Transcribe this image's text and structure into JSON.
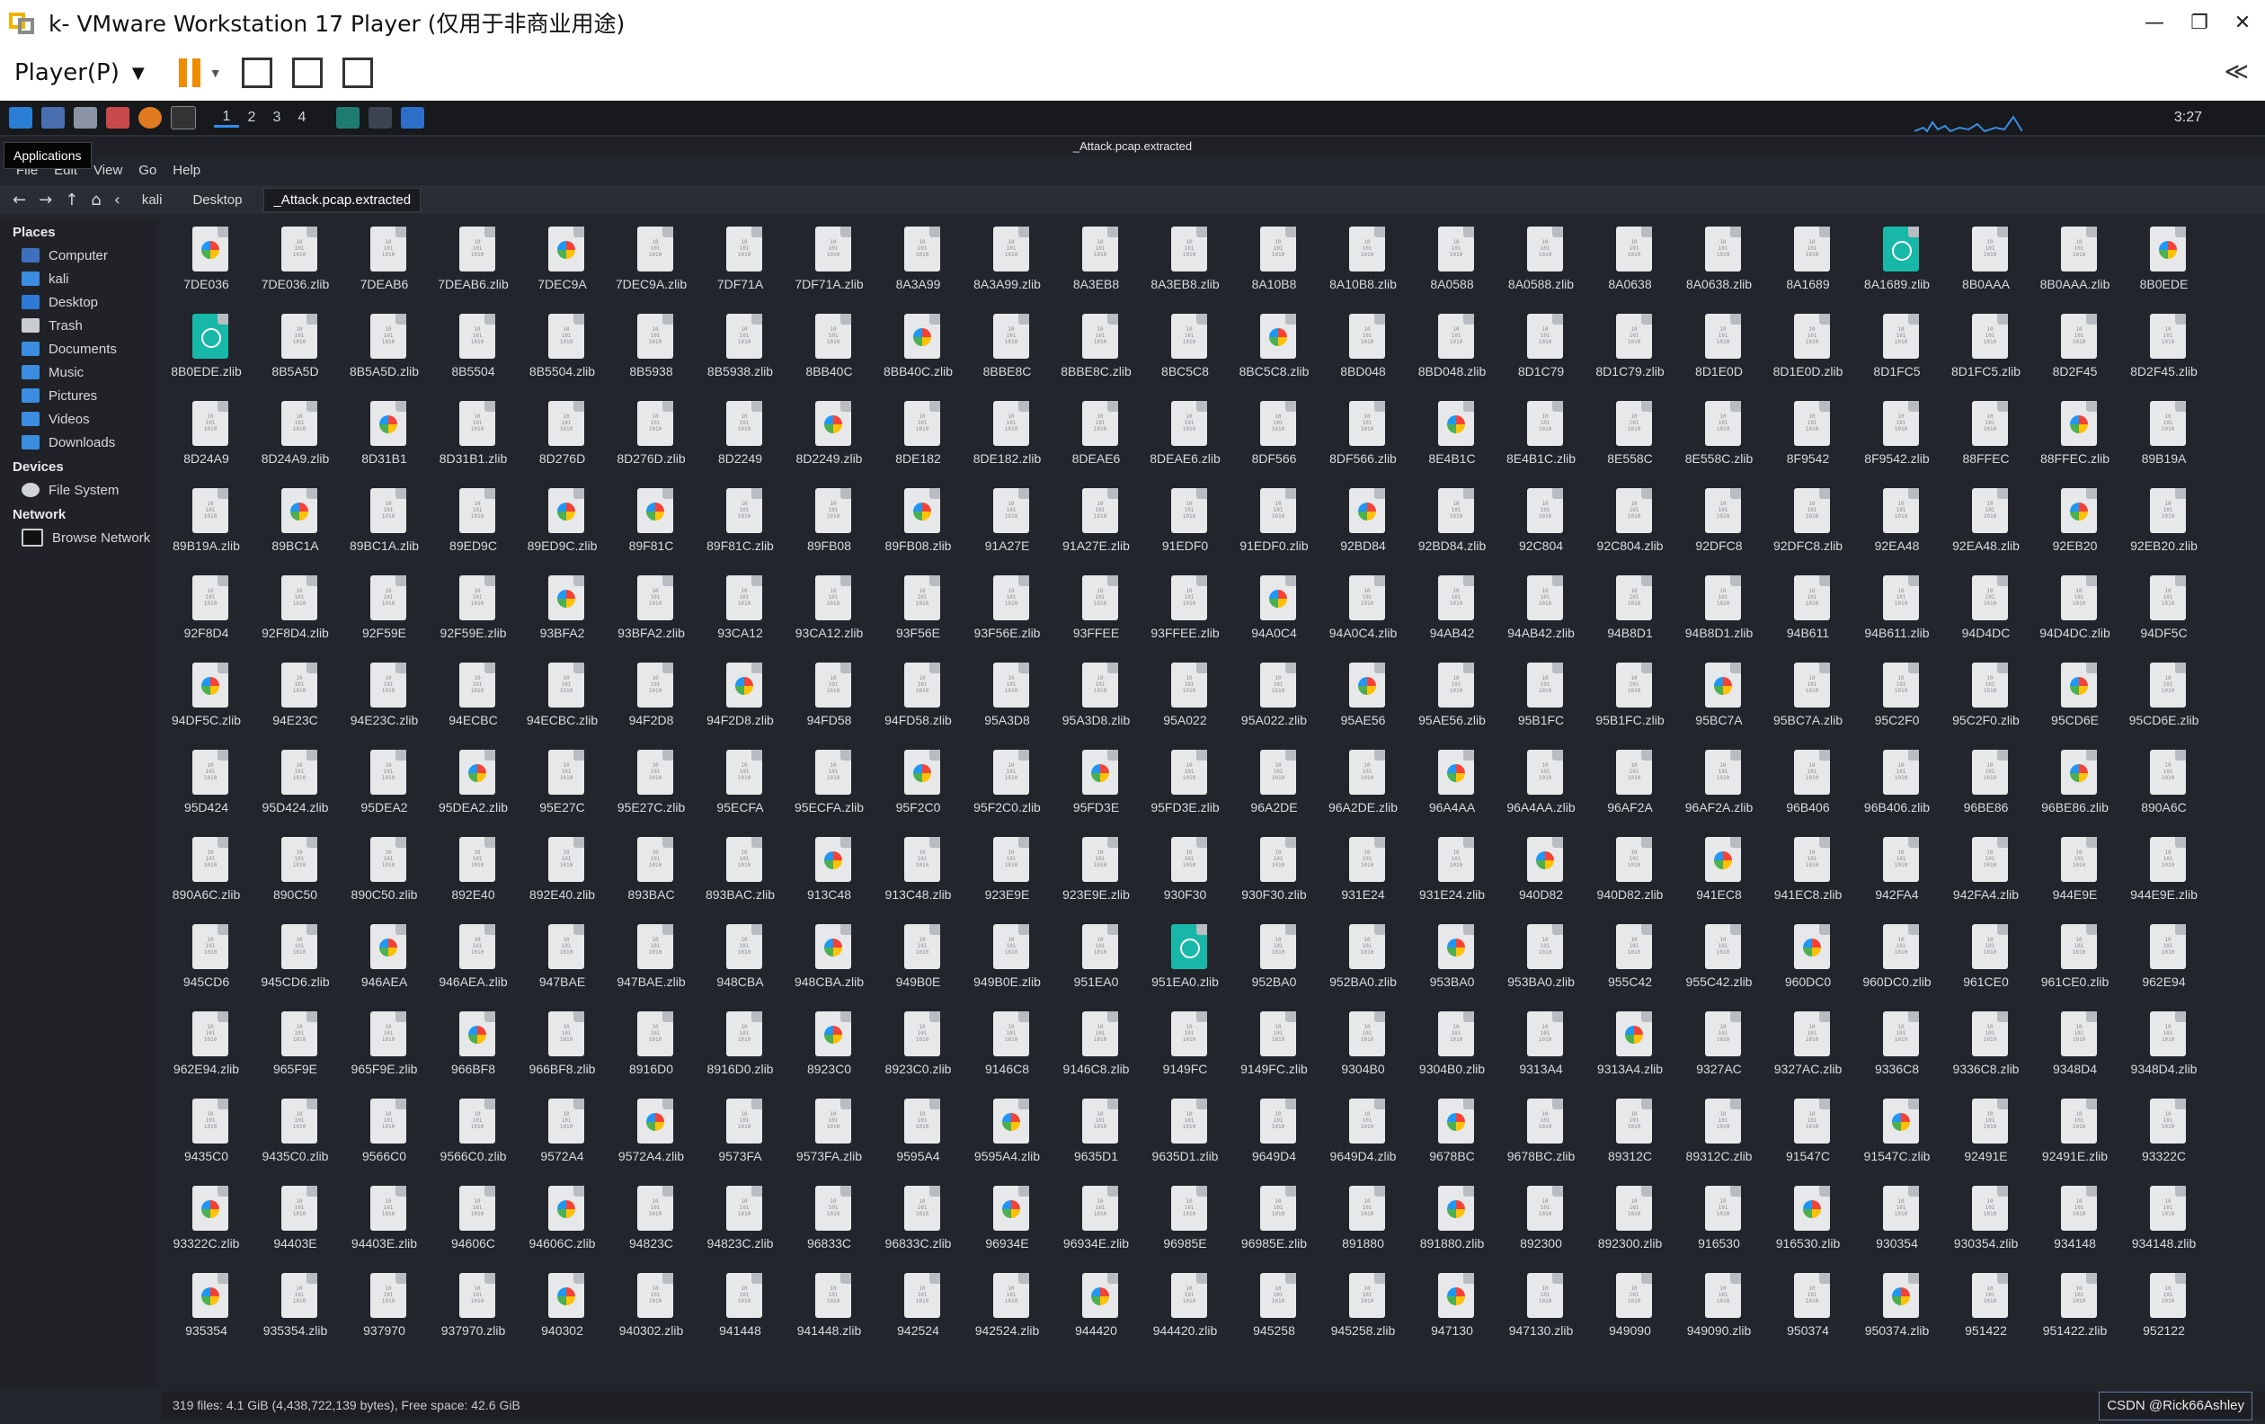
{
  "host": {
    "title": "k- VMware Workstation 17 Player (仅用于非商业用途)",
    "player_menu": "Player(P)",
    "caret": "▼",
    "minimize": "—",
    "maximize": "❐",
    "close": "✕",
    "collapse": "≪",
    "accent_pause": "#f08c00"
  },
  "guest_panel": {
    "workspaces": [
      "1",
      "2",
      "3",
      "4"
    ],
    "clock": "3:27"
  },
  "thunar": {
    "window_title": "_Attack.pcap.extracted",
    "tooltip": "Applications",
    "menu": [
      "File",
      "Edit",
      "View",
      "Go",
      "Help"
    ],
    "breadcrumbs": [
      "kali",
      "Desktop",
      "_Attack.pcap.extracted"
    ],
    "sidebar": {
      "places_header": "Places",
      "places": [
        "Computer",
        "kali",
        "Desktop",
        "Trash",
        "Documents",
        "Music",
        "Pictures",
        "Videos",
        "Downloads"
      ],
      "devices_header": "Devices",
      "devices": [
        "File System"
      ],
      "network_header": "Network",
      "network": [
        "Browse Network"
      ]
    },
    "status": "319 files: 4.1 GiB (4,438,722,139 bytes), Free space: 42.6 GiB",
    "watermark": "CSDN @Rick66Ashley",
    "bin_glyph": "10\n101\n1010",
    "files": [
      "7DE036",
      "7DE036.zlib",
      "7DEAB6",
      "7DEAB6.zlib",
      "7DEC9A",
      "7DEC9A.zlib",
      "7DF71A",
      "7DF71A.zlib",
      "8A3A99",
      "8A3A99.zlib",
      "8A3EB8",
      "8A3EB8.zlib",
      "8A10B8",
      "8A10B8.zlib",
      "8A0588",
      "8A0588.zlib",
      "8A0638",
      "8A0638.zlib",
      "8A1689",
      "8A1689.zlib",
      "8B0AAA",
      "8B0AAA.zlib",
      "8B0EDE",
      "8B0EDE.zlib",
      "8B5A5D",
      "8B5A5D.zlib",
      "8B5504",
      "8B5504.zlib",
      "8B5938",
      "8B5938.zlib",
      "8BB40C",
      "8BB40C.zlib",
      "8BBE8C",
      "8BBE8C.zlib",
      "8BC5C8",
      "8BC5C8.zlib",
      "8BD048",
      "8BD048.zlib",
      "8D1C79",
      "8D1C79.zlib",
      "8D1E0D",
      "8D1E0D.zlib",
      "8D1FC5",
      "8D1FC5.zlib",
      "8D2F45",
      "8D2F45.zlib",
      "8D24A9",
      "8D24A9.zlib",
      "8D31B1",
      "8D31B1.zlib",
      "8D276D",
      "8D276D.zlib",
      "8D2249",
      "8D2249.zlib",
      "8DE182",
      "8DE182.zlib",
      "8DEAE6",
      "8DEAE6.zlib",
      "8DF566",
      "8DF566.zlib",
      "8E4B1C",
      "8E4B1C.zlib",
      "8E558C",
      "8E558C.zlib",
      "8F9542",
      "8F9542.zlib",
      "88FFEC",
      "88FFEC.zlib",
      "89B19A",
      "89B19A.zlib",
      "89BC1A",
      "89BC1A.zlib",
      "89ED9C",
      "89ED9C.zlib",
      "89F81C",
      "89F81C.zlib",
      "89FB08",
      "89FB08.zlib",
      "91A27E",
      "91A27E.zlib",
      "91EDF0",
      "91EDF0.zlib",
      "92BD84",
      "92BD84.zlib",
      "92C804",
      "92C804.zlib",
      "92DFC8",
      "92DFC8.zlib",
      "92EA48",
      "92EA48.zlib",
      "92EB20",
      "92EB20.zlib",
      "92F8D4",
      "92F8D4.zlib",
      "92F59E",
      "92F59E.zlib",
      "93BFA2",
      "93BFA2.zlib",
      "93CA12",
      "93CA12.zlib",
      "93F56E",
      "93F56E.zlib",
      "93FFEE",
      "93FFEE.zlib",
      "94A0C4",
      "94A0C4.zlib",
      "94AB42",
      "94AB42.zlib",
      "94B8D1",
      "94B8D1.zlib",
      "94B611",
      "94B611.zlib",
      "94D4DC",
      "94D4DC.zlib",
      "94DF5C",
      "94DF5C.zlib",
      "94E23C",
      "94E23C.zlib",
      "94ECBC",
      "94ECBC.zlib",
      "94F2D8",
      "94F2D8.zlib",
      "94FD58",
      "94FD58.zlib",
      "95A3D8",
      "95A3D8.zlib",
      "95A022",
      "95A022.zlib",
      "95AE56",
      "95AE56.zlib",
      "95B1FC",
      "95B1FC.zlib",
      "95BC7A",
      "95BC7A.zlib",
      "95C2F0",
      "95C2F0.zlib",
      "95CD6E",
      "95CD6E.zlib",
      "95D424",
      "95D424.zlib",
      "95DEA2",
      "95DEA2.zlib",
      "95E27C",
      "95E27C.zlib",
      "95ECFA",
      "95ECFA.zlib",
      "95F2C0",
      "95F2C0.zlib",
      "95FD3E",
      "95FD3E.zlib",
      "96A2DE",
      "96A2DE.zlib",
      "96A4AA",
      "96A4AA.zlib",
      "96AF2A",
      "96AF2A.zlib",
      "96B406",
      "96B406.zlib",
      "96BE86",
      "96BE86.zlib",
      "890A6C",
      "890A6C.zlib",
      "890C50",
      "890C50.zlib",
      "892E40",
      "892E40.zlib",
      "893BAC",
      "893BAC.zlib",
      "913C48",
      "913C48.zlib",
      "923E9E",
      "923E9E.zlib",
      "930F30",
      "930F30.zlib",
      "931E24",
      "931E24.zlib",
      "940D82",
      "940D82.zlib",
      "941EC8",
      "941EC8.zlib",
      "942FA4",
      "942FA4.zlib",
      "944E9E",
      "944E9E.zlib",
      "945CD6",
      "945CD6.zlib",
      "946AEA",
      "946AEA.zlib",
      "947BAE",
      "947BAE.zlib",
      "948CBA",
      "948CBA.zlib",
      "949B0E",
      "949B0E.zlib",
      "951EA0",
      "951EA0.zlib",
      "952BA0",
      "952BA0.zlib",
      "953BA0",
      "953BA0.zlib",
      "955C42",
      "955C42.zlib",
      "960DC0",
      "960DC0.zlib",
      "961CE0",
      "961CE0.zlib",
      "962E94",
      "962E94.zlib",
      "965F9E",
      "965F9E.zlib",
      "966BF8",
      "966BF8.zlib",
      "8916D0",
      "8916D0.zlib",
      "8923C0",
      "8923C0.zlib",
      "9146C8",
      "9146C8.zlib",
      "9149FC",
      "9149FC.zlib",
      "9304B0",
      "9304B0.zlib",
      "9313A4",
      "9313A4.zlib",
      "9327AC",
      "9327AC.zlib",
      "9336C8",
      "9336C8.zlib",
      "9348D4",
      "9348D4.zlib",
      "9435C0",
      "9435C0.zlib",
      "9566C0",
      "9566C0.zlib",
      "9572A4",
      "9572A4.zlib",
      "9573FA",
      "9573FA.zlib",
      "9595A4",
      "9595A4.zlib",
      "9635D1",
      "9635D1.zlib",
      "9649D4",
      "9649D4.zlib",
      "9678BC",
      "9678BC.zlib",
      "89312C",
      "89312C.zlib",
      "91547C",
      "91547C.zlib",
      "92491E",
      "92491E.zlib",
      "93322C",
      "93322C.zlib",
      "94403E",
      "94403E.zlib",
      "94606C",
      "94606C.zlib",
      "94823C",
      "94823C.zlib",
      "96833C",
      "96833C.zlib",
      "96934E",
      "96934E.zlib",
      "96985E",
      "96985E.zlib",
      "891880",
      "891880.zlib",
      "892300",
      "892300.zlib",
      "916530",
      "916530.zlib",
      "930354",
      "930354.zlib",
      "934148",
      "934148.zlib",
      "935354",
      "935354.zlib",
      "937970",
      "937970.zlib",
      "940302",
      "940302.zlib",
      "941448",
      "941448.zlib",
      "942524",
      "942524.zlib",
      "944420",
      "944420.zlib",
      "945258",
      "945258.zlib",
      "947130",
      "947130.zlib",
      "949090",
      "949090.zlib",
      "950374",
      "950374.zlib",
      "951422",
      "951422.zlib",
      "952122"
    ],
    "image_icon_indices": [
      0,
      4,
      22,
      31,
      35,
      48,
      53,
      60,
      67,
      70,
      73,
      74,
      77,
      82,
      90,
      96,
      104,
      115,
      121,
      128,
      132,
      136,
      141,
      146,
      148,
      152,
      159,
      168,
      176,
      178,
      186,
      191,
      198,
      202,
      210,
      214,
      223,
      235,
      239,
      244,
      249,
      253,
      257,
      262,
      267,
      271,
      276,
      280,
      286,
      290,
      295,
      299,
      302,
      306,
      311,
      315,
      322,
      325,
      332,
      336,
      338,
      343,
      352,
      356,
      359,
      362,
      365,
      368,
      371,
      374,
      377,
      380,
      384,
      386,
      390,
      393,
      396,
      399,
      402,
      405,
      408,
      411,
      414,
      417,
      420,
      422
    ],
    "web_icon_indices": [
      19,
      23,
      195
    ]
  }
}
